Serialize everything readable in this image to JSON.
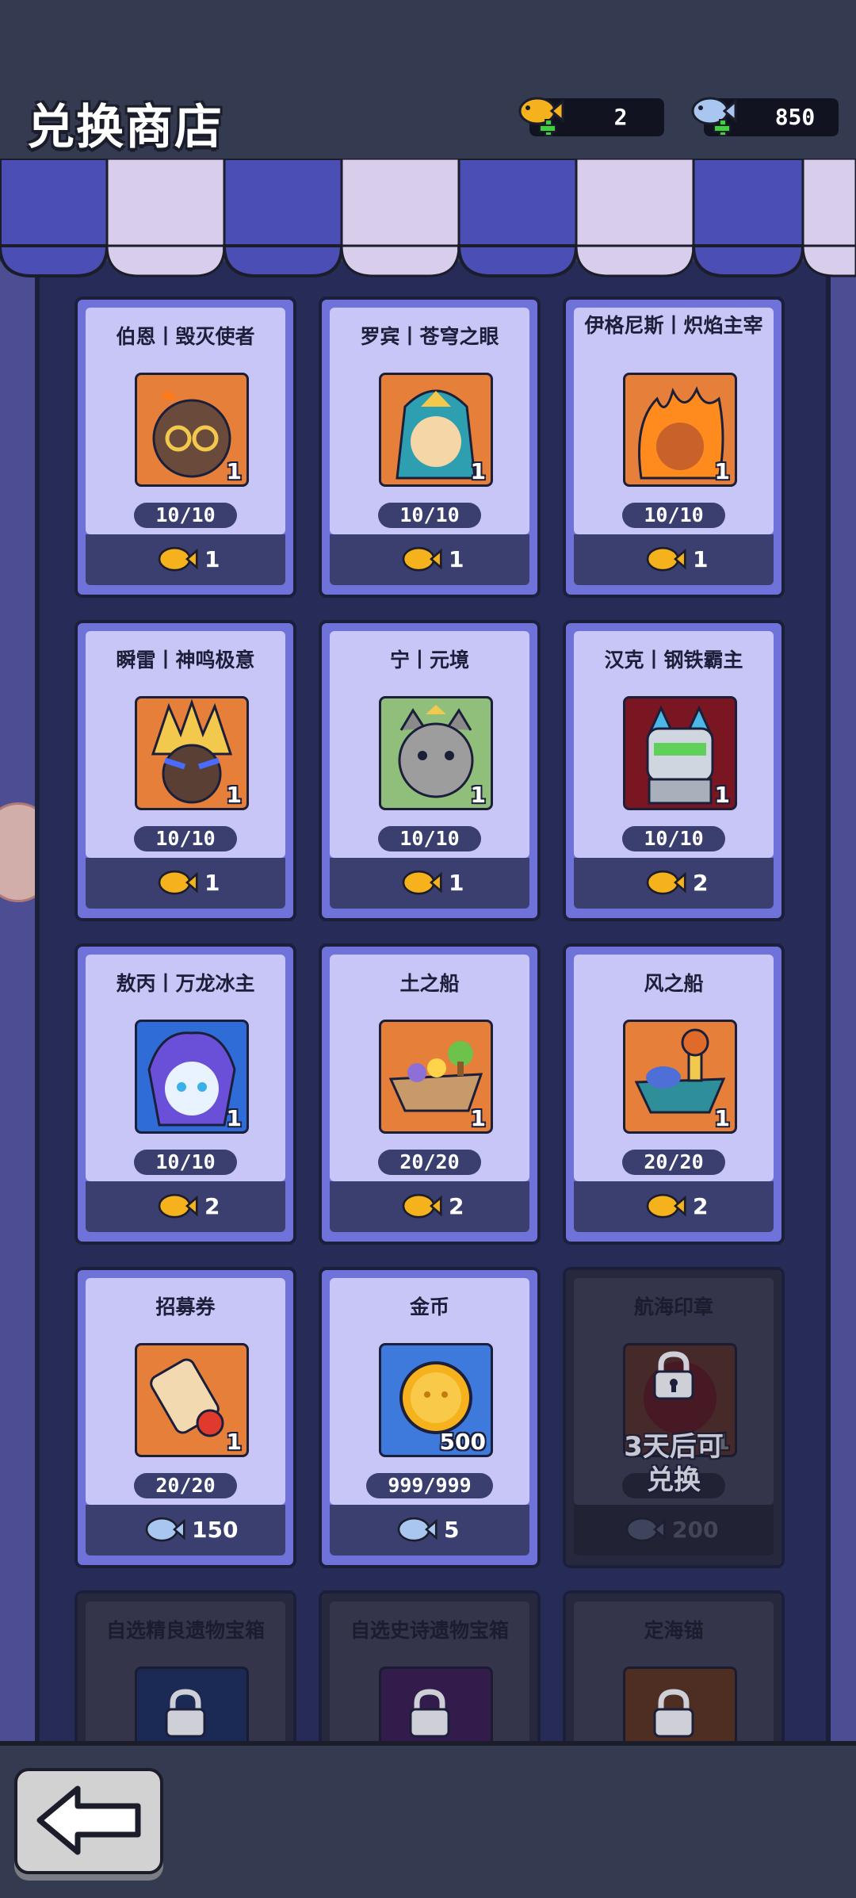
{
  "header": {
    "title": "兑换商店",
    "currencies": [
      {
        "icon": "gold-fish-icon",
        "value": "2"
      },
      {
        "icon": "blue-fish-icon",
        "value": "850"
      }
    ]
  },
  "items": [
    {
      "name": "伯恩丨毁灭使者",
      "qty": "1",
      "stock": "10/10",
      "price": "1",
      "currency": "gold-fish-icon",
      "art": "hero-bern-icon"
    },
    {
      "name": "罗宾丨苍穹之眼",
      "qty": "1",
      "stock": "10/10",
      "price": "1",
      "currency": "gold-fish-icon",
      "art": "hero-robin-icon"
    },
    {
      "name": "伊格尼斯丨炽焰主宰",
      "qty": "1",
      "stock": "10/10",
      "price": "1",
      "currency": "gold-fish-icon",
      "art": "hero-ignis-icon"
    },
    {
      "name": "瞬雷丨神鸣极意",
      "qty": "1",
      "stock": "10/10",
      "price": "1",
      "currency": "gold-fish-icon",
      "art": "hero-shunlei-icon"
    },
    {
      "name": "宁丨元境",
      "qty": "1",
      "stock": "10/10",
      "price": "1",
      "currency": "gold-fish-icon",
      "art": "hero-ning-icon"
    },
    {
      "name": "汉克丨钢铁霸主",
      "qty": "1",
      "stock": "10/10",
      "price": "2",
      "currency": "gold-fish-icon",
      "art": "hero-hank-icon"
    },
    {
      "name": "敖丙丨万龙冰主",
      "qty": "1",
      "stock": "10/10",
      "price": "2",
      "currency": "gold-fish-icon",
      "art": "hero-aobing-icon"
    },
    {
      "name": "土之船",
      "qty": "1",
      "stock": "20/20",
      "price": "2",
      "currency": "gold-fish-icon",
      "art": "earth-ship-icon"
    },
    {
      "name": "风之船",
      "qty": "1",
      "stock": "20/20",
      "price": "2",
      "currency": "gold-fish-icon",
      "art": "wind-ship-icon"
    },
    {
      "name": "招募券",
      "qty": "1",
      "stock": "20/20",
      "price": "150",
      "currency": "blue-fish-icon",
      "art": "recruit-scroll-icon"
    },
    {
      "name": "金币",
      "qty": "500",
      "stock": "999/999",
      "price": "5",
      "currency": "blue-fish-icon",
      "art": "gold-coin-icon"
    },
    {
      "name": "航海印章",
      "qty": "1",
      "stock": "",
      "price": "200",
      "currency": "blue-fish-icon",
      "art": "voyage-seal-icon",
      "locked": true,
      "lock_text_1": "3天后可",
      "lock_text_2": "兑换"
    },
    {
      "name": "自选精良遗物宝箱",
      "locked": true,
      "art": "relic-chest-blue-icon"
    },
    {
      "name": "自选史诗遗物宝箱",
      "locked": true,
      "art": "relic-chest-purple-icon"
    },
    {
      "name": "定海锚",
      "locked": true,
      "art": "anchor-icon"
    }
  ],
  "back": {
    "icon": "back-arrow-icon"
  }
}
